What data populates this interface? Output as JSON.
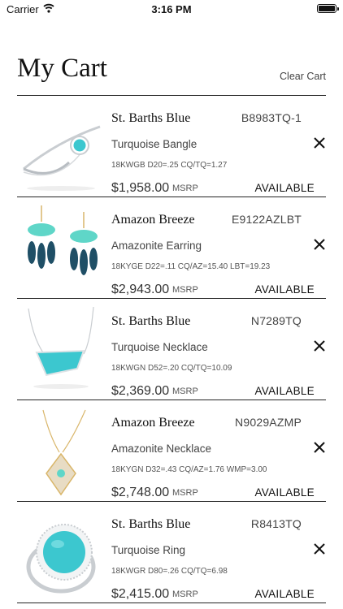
{
  "status_bar": {
    "carrier": "Carrier",
    "time": "3:16 PM"
  },
  "header": {
    "title": "My Cart",
    "clear_label": "Clear Cart"
  },
  "cart": {
    "items": [
      {
        "collection": "St. Barths Blue",
        "sku": "B8983TQ-1",
        "description": "Turquoise Bangle",
        "specs": "18KWGB D20=.25 CQ/TQ=1.27",
        "price": "$1,958.00",
        "msrp_label": "MSRP",
        "availability": "AVAILABLE",
        "thumb_icon": "bangle-icon"
      },
      {
        "collection": "Amazon Breeze",
        "sku": "E9122AZLBT",
        "description": "Amazonite Earring",
        "specs": "18KYGE D22=.11 CQ/AZ=15.40 LBT=19.23",
        "price": "$2,943.00",
        "msrp_label": "MSRP",
        "availability": "AVAILABLE",
        "thumb_icon": "earring-icon"
      },
      {
        "collection": "St. Barths Blue",
        "sku": "N7289TQ",
        "description": "Turquoise Necklace",
        "specs": "18KWGN D52=.20 CQ/TQ=10.09",
        "price": "$2,369.00",
        "msrp_label": "MSRP",
        "availability": "AVAILABLE",
        "thumb_icon": "necklace-icon"
      },
      {
        "collection": "Amazon Breeze",
        "sku": "N9029AZMP",
        "description": "Amazonite Necklace",
        "specs": "18KYGN D32=.43 CQ/AZ=1.76 WMP=3.00",
        "price": "$2,748.00",
        "msrp_label": "MSRP",
        "availability": "AVAILABLE",
        "thumb_icon": "pendant-icon"
      },
      {
        "collection": "St. Barths Blue",
        "sku": "R8413TQ",
        "description": "Turquoise Ring",
        "specs": "18KWGR D80=.26 CQ/TQ=6.98",
        "price": "$2,415.00",
        "msrp_label": "MSRP",
        "availability": "AVAILABLE",
        "thumb_icon": "ring-icon"
      }
    ]
  },
  "colors": {
    "turquoise": "#3cc7cf",
    "amazonite": "#5fd6c8",
    "london_blue": "#1f4f66",
    "white_gold": "#c9cdd1",
    "yellow_gold": "#d9b66a"
  }
}
